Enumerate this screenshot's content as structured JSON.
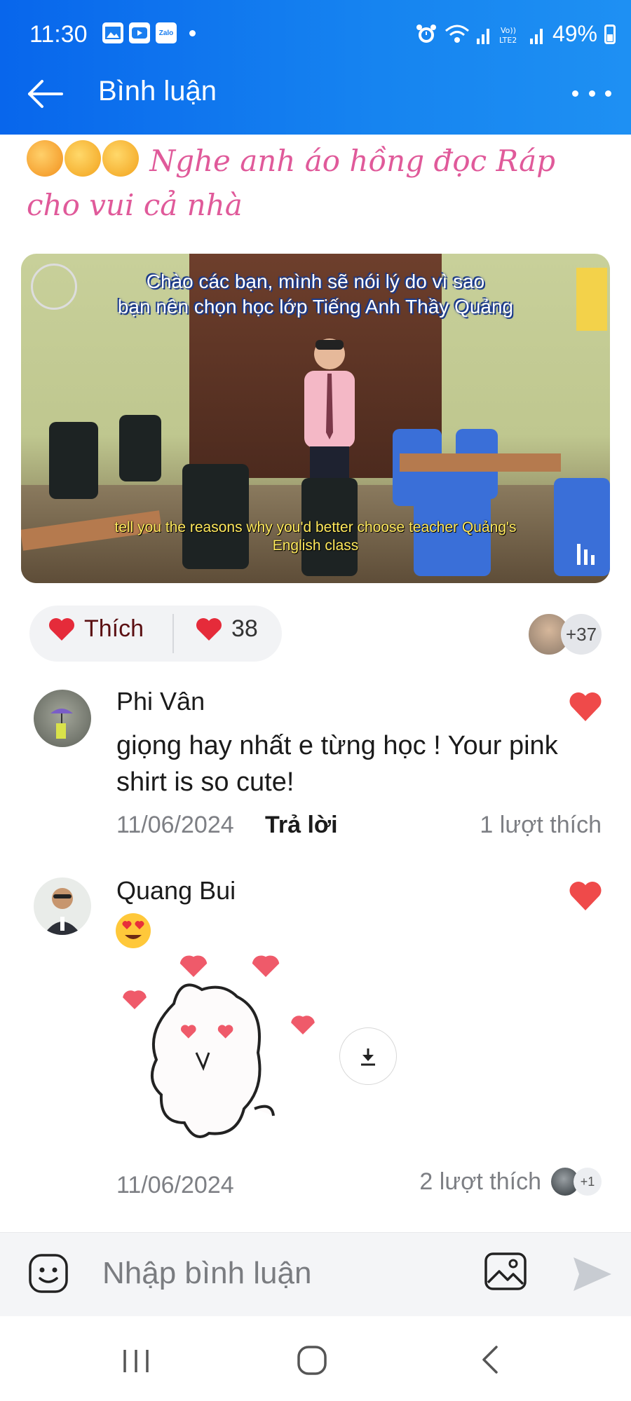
{
  "status_bar": {
    "time": "11:30",
    "battery": "49%",
    "left_icons": [
      "gallery-icon",
      "youtube-icon",
      "zalo-icon",
      "dot-icon"
    ],
    "right_icons": [
      "alarm-icon",
      "wifi-icon",
      "signal-icon",
      "volte-icon",
      "signal-icon",
      "battery-icon"
    ]
  },
  "header": {
    "title": "Bình luận",
    "back_icon": "arrow-left-icon",
    "more_icon": "more-icon"
  },
  "post": {
    "text": "Nghe anh áo hồng đọc Ráp cho vui cả nhà",
    "video": {
      "subtitle_top_line1": "Chào các bạn, mình sẽ nói lý do vì sao",
      "subtitle_top_line2": "bạn nên chọn học lớp Tiếng Anh Thầy Quảng",
      "subtitle_bottom_line1": "tell you the reasons why you'd better choose teacher Quảng's",
      "subtitle_bottom_line2": "English class"
    },
    "like_label": "Thích",
    "reaction_count": "38",
    "viewers_more": "+37"
  },
  "comments": [
    {
      "name": "Phi Vân",
      "text": "giọng hay nhất e từng học ! Your pink shirt is so cute!",
      "date": "11/06/2024",
      "reply_label": "Trả lời",
      "likes": "1 lượt thích"
    },
    {
      "name": "Quang Bui",
      "date": "11/06/2024",
      "likes": "2 lượt thích",
      "likers_more": "+1"
    }
  ],
  "input": {
    "placeholder": "Nhập bình luận"
  },
  "colors": {
    "header_blue": "#0866ec",
    "post_pink": "#e05a9a",
    "heart_red": "#ef4a4a"
  }
}
